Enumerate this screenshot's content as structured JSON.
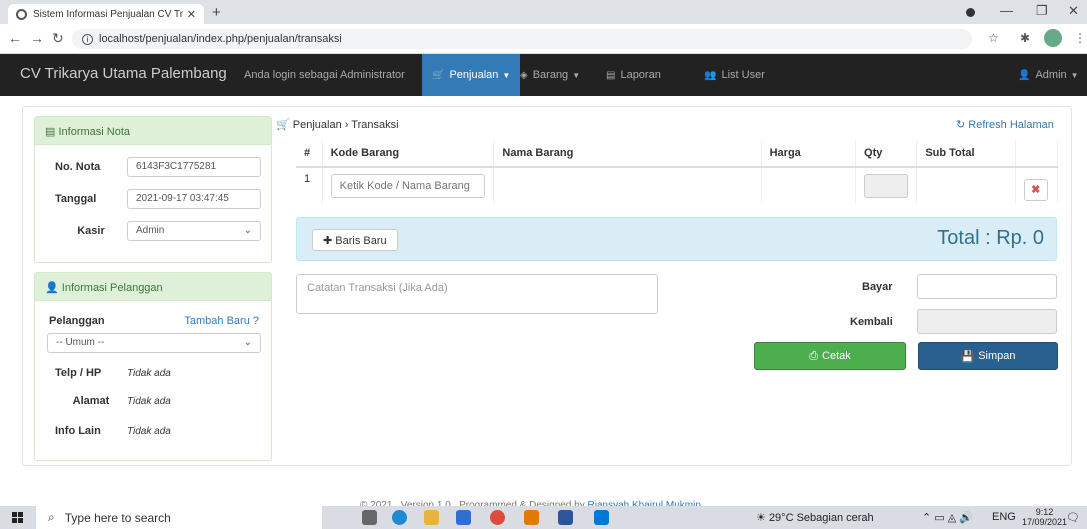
{
  "browser": {
    "tab_title": "Sistem Informasi Penjualan CV Tr",
    "url": "localhost/penjualan/index.php/penjualan/transaksi"
  },
  "navbar": {
    "brand": "CV Trikarya Utama Palembang",
    "login_text": "Anda login sebagai Administrator",
    "menu": [
      "Penjualan",
      "Barang",
      "Laporan",
      "List User"
    ],
    "user": "Admin"
  },
  "nota": {
    "title": "Informasi Nota",
    "no_label": "No. Nota",
    "no_value": "6143F3C1775281",
    "date_label": "Tanggal",
    "date_value": "2021-09-17 03:47:45",
    "cashier_label": "Kasir",
    "cashier_value": "Admin"
  },
  "customer": {
    "title": "Informasi Pelanggan",
    "customer_label": "Pelanggan",
    "add_new": "Tambah Baru ?",
    "customer_value": "-- Umum --",
    "phone_label": "Telp / HP",
    "phone_value": "Tidak ada",
    "address_label": "Alamat",
    "address_value": "Tidak ada",
    "other_label": "Info Lain",
    "other_value": "Tidak ada"
  },
  "transaction": {
    "breadcrumb_root": "Penjualan",
    "breadcrumb_sep": "›",
    "breadcrumb_current": "Transaksi",
    "refresh": "Refresh Halaman",
    "columns": [
      "#",
      "Kode Barang",
      "Nama Barang",
      "Harga",
      "Qty",
      "Sub Total"
    ],
    "row_number": "1",
    "code_placeholder": "Ketik Kode / Nama Barang",
    "add_row": "Baris Baru",
    "total": "Total : Rp. 0",
    "notes_placeholder": "Catatan Transaksi (Jika Ada)",
    "pay_label": "Bayar",
    "change_label": "Kembali",
    "print": "Cetak",
    "save": "Simpan"
  },
  "footer": {
    "text": "© 2021 . Version 1.0 . Programmed & Designed by",
    "author": "Riansyah Khairul Mukmin"
  },
  "taskbar": {
    "search": "Type here to search",
    "weather": "29°C  Sebagian cerah",
    "lang": "ENG",
    "time": "9:12",
    "date": "17/09/2021"
  }
}
